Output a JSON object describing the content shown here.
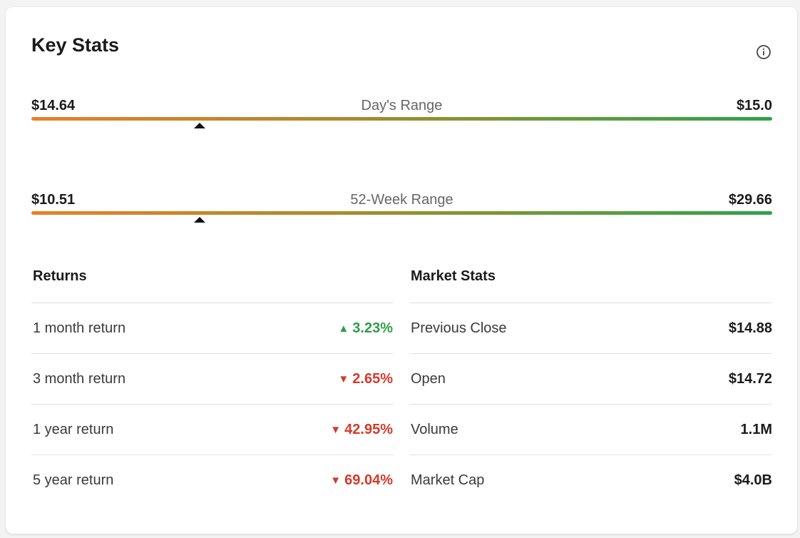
{
  "card": {
    "title": "Key Stats"
  },
  "icons": {
    "info": "info-circle-icon"
  },
  "days_range": {
    "low": "$14.64",
    "label": "Day's Range",
    "high": "$15.0",
    "marker_fraction": 0.227
  },
  "week52_range": {
    "low": "$10.51",
    "label": "52-Week Range",
    "high": "$29.66",
    "marker_fraction": 0.227
  },
  "returns": {
    "heading": "Returns",
    "rows": [
      {
        "label": "1 month return",
        "value": "3.23%",
        "direction": "up",
        "arrow": "▲"
      },
      {
        "label": "3 month return",
        "value": "2.65%",
        "direction": "down",
        "arrow": "▼"
      },
      {
        "label": "1 year return",
        "value": "42.95%",
        "direction": "down",
        "arrow": "▼"
      },
      {
        "label": "5 year return",
        "value": "69.04%",
        "direction": "down",
        "arrow": "▼"
      }
    ]
  },
  "market_stats": {
    "heading": "Market Stats",
    "rows": [
      {
        "label": "Previous Close",
        "value": "$14.88"
      },
      {
        "label": "Open",
        "value": "$14.72"
      },
      {
        "label": "Volume",
        "value": "1.1M"
      },
      {
        "label": "Market Cap",
        "value": "$4.0B"
      }
    ]
  },
  "colors": {
    "positive": "#2e9e47",
    "negative": "#d43a2a",
    "range_start": "#e8802b",
    "range_end": "#2ea24a"
  }
}
